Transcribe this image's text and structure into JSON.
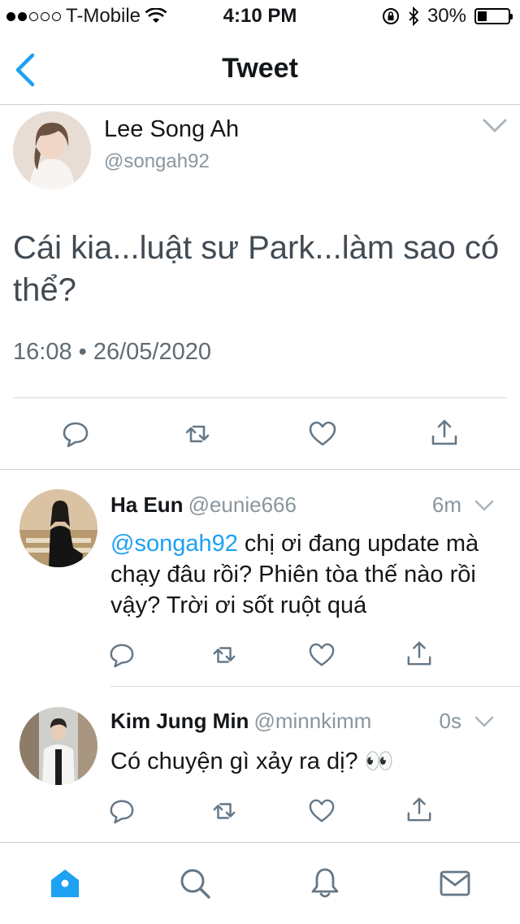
{
  "status_bar": {
    "carrier": "T-Mobile",
    "time": "4:10 PM",
    "battery": "30%",
    "battery_level": 0.3,
    "signal_bars": 2
  },
  "nav": {
    "title": "Tweet",
    "back_icon": "chevron-left-icon"
  },
  "main_tweet": {
    "name": "Lee Song Ah",
    "handle": "@songah92",
    "text": "Cái kia...luật sư Park...làm sao có thể?",
    "timestamp": "16:08 • 26/05/2020"
  },
  "replies": [
    {
      "name": "Ha Eun",
      "handle": "@eunie666",
      "time": "6m",
      "mention": "@songah92",
      "text": " chị ơi đang update mà chạy đâu rồi? Phiên tòa thế nào rồi vậy? Trời ơi sốt ruột quá"
    },
    {
      "name": "Kim Jung Min",
      "handle": "@minnkimm",
      "time": "0s",
      "text": "Có chuyện gì xảy ra dị? 👀"
    }
  ],
  "colors": {
    "accent": "#1da1f2",
    "icon": "#657786",
    "text": "#14171a",
    "muted": "#8a959e"
  },
  "tabs": [
    "home-icon",
    "search-icon",
    "notifications-icon",
    "messages-icon"
  ]
}
